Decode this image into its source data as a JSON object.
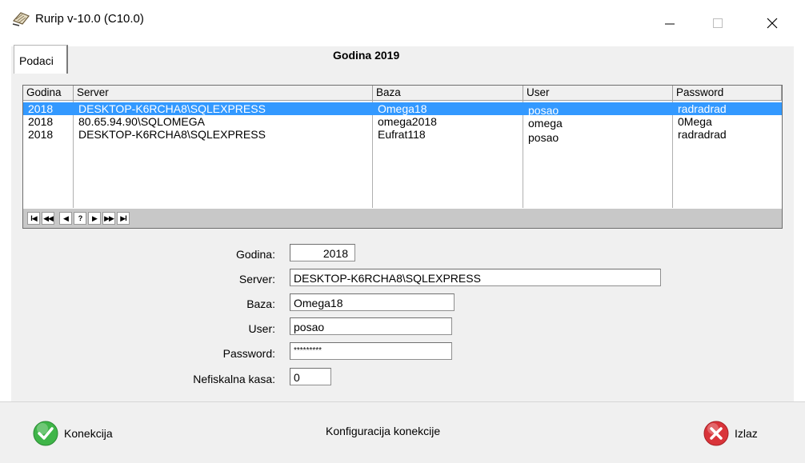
{
  "window": {
    "title": "Rurip v-10.0 (C10.0)",
    "minimize": "—",
    "maximize": "☐",
    "close": "✕"
  },
  "tab": {
    "label": "Podaci"
  },
  "header": {
    "title": "Godina 2019"
  },
  "grid": {
    "columns": [
      "Godina",
      "Server",
      "Baza",
      "User",
      "Password"
    ],
    "rows": [
      [
        "2018",
        "DESKTOP-K6RCHA8\\SQLEXPRESS",
        "Omega18",
        "posao",
        "radradrad"
      ],
      [
        "2018",
        "80.65.94.90\\SQLOMEGA",
        "omega2018",
        "omega",
        "0Mega"
      ],
      [
        "2018",
        "DESKTOP-K6RCHA8\\SQLEXPRESS",
        "Eufrat118",
        "posao",
        "radradrad"
      ]
    ],
    "selected_row": 0,
    "nav": [
      "I◀",
      "◀◀",
      "◀",
      "?",
      "▶",
      "▶▶",
      "▶I"
    ]
  },
  "form": {
    "godina_label": "Godina:",
    "godina_value": "2018",
    "server_label": "Server:",
    "server_value": "DESKTOP-K6RCHA8\\SQLEXPRESS",
    "baza_label": "Baza:",
    "baza_value": "Omega18",
    "user_label": "User:",
    "user_value": "posao",
    "password_label": "Password:",
    "password_value": "*********",
    "kasa_label": "Nefiskalna kasa:",
    "kasa_value": "0"
  },
  "footer": {
    "connect_label": "Konekcija",
    "status": "Konfiguracija konekcije",
    "exit_label": "Izlaz"
  },
  "colors": {
    "selection": "#3399ff",
    "connect_green": "#3fb548",
    "exit_red": "#d9343a"
  }
}
